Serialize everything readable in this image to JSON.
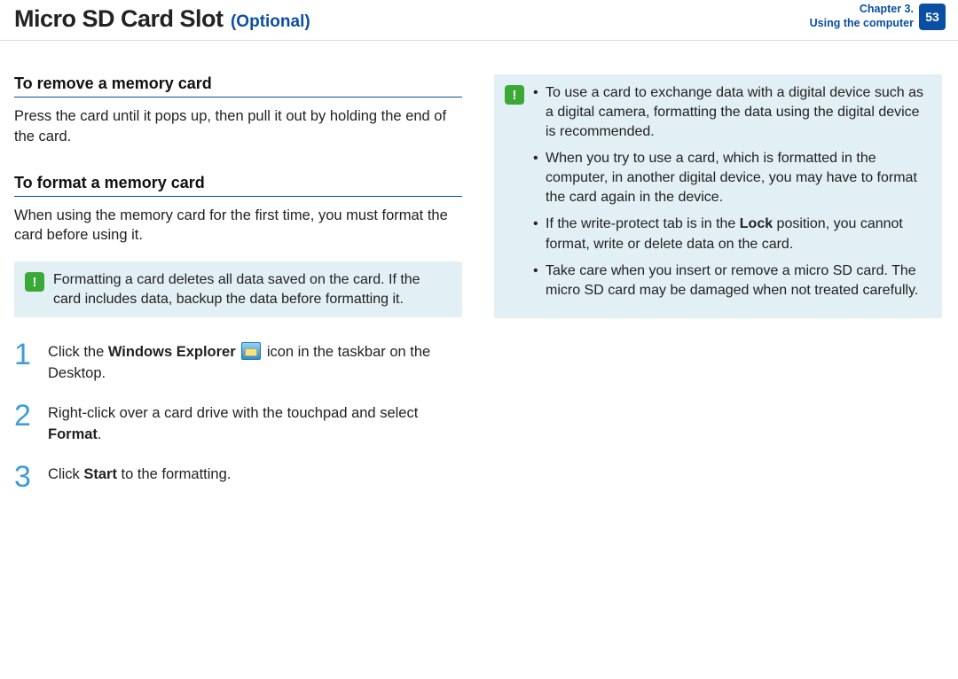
{
  "header": {
    "title": "Micro SD Card Slot",
    "optional": "(Optional)",
    "chapter_line1": "Chapter 3.",
    "chapter_line2": "Using the computer",
    "page": "53"
  },
  "left": {
    "sec1_title": "To remove a memory card",
    "sec1_body": "Press the card until it pops up, then pull it out by holding the end of the card.",
    "sec2_title": "To format a memory card",
    "sec2_body": "When using the memory card for the first time, you must format the card before using it.",
    "note": "Formatting a card deletes all data saved on the card. If the card includes data, backup the data before formatting it.",
    "steps": [
      {
        "num": "1",
        "pre": "Click the ",
        "bold1": "Windows Explorer",
        "mid": " icon in the taskbar on the Desktop.",
        "has_icon": true
      },
      {
        "num": "2",
        "pre": "Right-click over a card drive with the touchpad and select ",
        "bold1": "Format",
        "mid": ".",
        "has_icon": false
      },
      {
        "num": "3",
        "pre": "Click ",
        "bold1": "Start",
        "mid": " to the formatting.",
        "has_icon": false
      }
    ]
  },
  "right": {
    "bullets": [
      {
        "t1": "To use a card to exchange data with a digital device such as a digital camera, formatting the data using the digital device is recommended."
      },
      {
        "t1": "When you try to use a card, which is formatted in the computer, in another digital device, you may have to format the card again in the device."
      },
      {
        "t1": "If the write-protect tab is in the ",
        "bold": "Lock",
        "t2": " position, you cannot format, write or delete data on the card."
      },
      {
        "t1": "Take care when you insert or remove a micro SD card. The micro SD card may be damaged when not treated carefully."
      }
    ]
  }
}
